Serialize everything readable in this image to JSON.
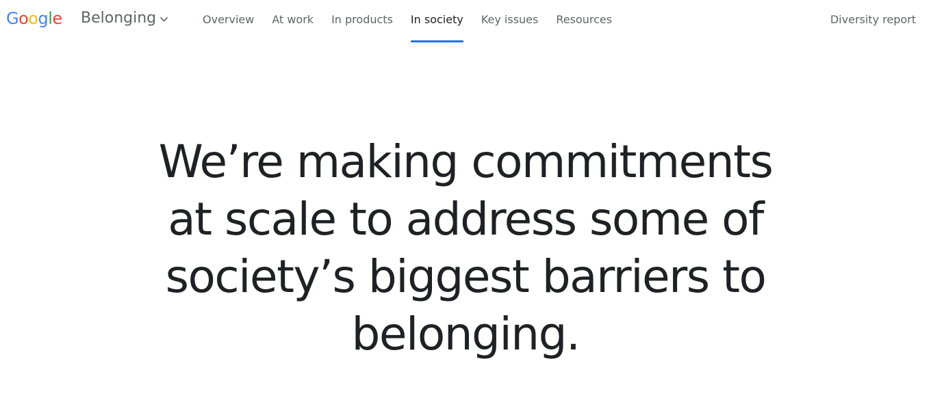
{
  "header": {
    "logo": {
      "letters": [
        {
          "char": "G",
          "color": "#4285F4"
        },
        {
          "char": "o",
          "color": "#EA4335"
        },
        {
          "char": "o",
          "color": "#FBBC05"
        },
        {
          "char": "g",
          "color": "#4285F4"
        },
        {
          "char": "l",
          "color": "#34A853"
        },
        {
          "char": "e",
          "color": "#EA4335"
        }
      ]
    },
    "product": {
      "name": "Belonging",
      "icon": "chevron-down-icon"
    },
    "nav": [
      {
        "label": "Overview",
        "active": false
      },
      {
        "label": "At work",
        "active": false
      },
      {
        "label": "In products",
        "active": false
      },
      {
        "label": "In society",
        "active": true
      },
      {
        "label": "Key issues",
        "active": false
      },
      {
        "label": "Resources",
        "active": false
      }
    ],
    "report_link": "Diversity report",
    "accent_color": "#1a73e8"
  },
  "hero": {
    "title": "We’re making commitments at scale to address some of society’s biggest barriers to belonging."
  }
}
